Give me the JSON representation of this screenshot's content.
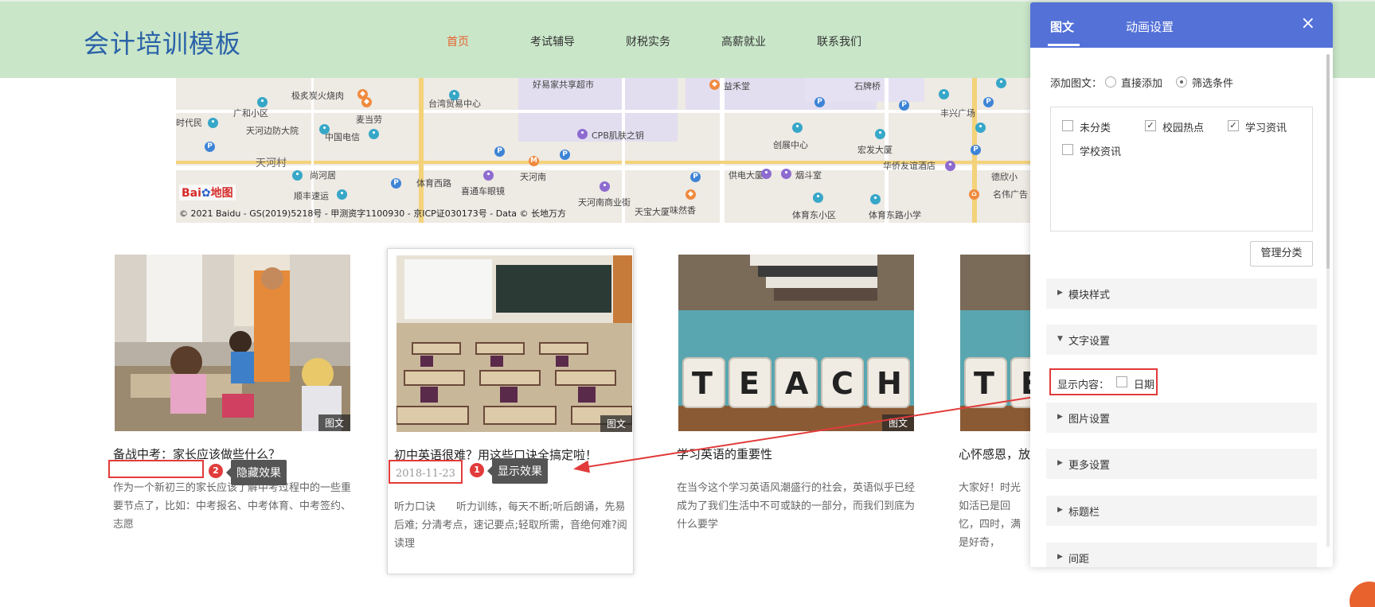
{
  "site": {
    "title": "会计培训模板"
  },
  "nav": [
    {
      "label": "首页",
      "active": true
    },
    {
      "label": "考试辅导",
      "active": false
    },
    {
      "label": "财税实务",
      "active": false
    },
    {
      "label": "高薪就业",
      "active": false
    },
    {
      "label": "联系我们",
      "active": false
    }
  ],
  "map": {
    "labels": [
      "极炙炭火烧肉",
      "广和小区",
      "天河边防大院",
      "时代民",
      "好易家共享超市",
      "麦当劳",
      "台湾贸易中心",
      "中国电信",
      "CPB肌肤之钥",
      "天河村",
      "尚河居",
      "顺丰速运",
      "体育西路",
      "喜通车眼镜",
      "天河南",
      "天河南商业街",
      "益禾堂",
      "石牌桥",
      "创展中心",
      "宏发大厦",
      "丰兴广场",
      "华侨友谊酒店",
      "供电大厦",
      "烟斗室",
      "味然香",
      "天宝大厦",
      "体育东小区",
      "体育东路小学",
      "德欣小",
      "名伟广告"
    ],
    "logo_text": "Bai",
    "logo_suffix": "地图",
    "copyright": "© 2021 Baidu - GS(2019)5218号 - 甲测资字1100930 - 京ICP证030173号 - Data © 长地万方"
  },
  "cards": [
    {
      "title": "备战中考：家长应该做些什么？",
      "date": "",
      "tag": "图文",
      "desc": "作为一个新初三的家长应该了解中考过程中的一些重要节点了，比如：中考报名、中考体育、中考签约、志愿"
    },
    {
      "title": "初中英语很难？用这些口诀全搞定啦！",
      "date": "2018-11-23",
      "tag": "图文",
      "desc": "听力口诀　　听力训练，每天不断;听后朗诵，先易后难; 分清考点，速记要点;轻取所需，音绝何难?阅读理"
    },
    {
      "title": "学习英语的重要性",
      "date": "",
      "tag": "图文",
      "desc": "在当今这个学习英语风潮盛行的社会，英语似乎已经成为了我们生活中不可或缺的一部分，而我们到底为什么要学"
    },
    {
      "title": "心怀感恩，放",
      "date": "",
      "tag": "",
      "desc": "大家好！时光如活已是回忆，四时，满是好奇，"
    }
  ],
  "teach_letters": [
    "T",
    "E",
    "A",
    "C",
    "H"
  ],
  "annotations": {
    "hide": {
      "num": "2",
      "label": "隐藏效果"
    },
    "show": {
      "num": "1",
      "label": "显示效果"
    }
  },
  "panel": {
    "tabs": [
      {
        "label": "图文",
        "active": true
      },
      {
        "label": "动画设置",
        "active": false
      }
    ],
    "close_icon": "×",
    "add_label": "添加图文：",
    "add_options": [
      {
        "label": "直接添加",
        "checked": false
      },
      {
        "label": "筛选条件",
        "checked": true
      }
    ],
    "categories": [
      {
        "label": "未分类",
        "checked": false
      },
      {
        "label": "校园热点",
        "checked": true
      },
      {
        "label": "学习资讯",
        "checked": true
      },
      {
        "label": "学校资讯",
        "checked": false
      }
    ],
    "manage_button": "管理分类",
    "sections": {
      "module_style": "模块样式",
      "text_settings": "文字设置",
      "image_settings": "图片设置",
      "more_settings": "更多设置",
      "title_bar": "标题栏",
      "spacing": "间距"
    },
    "display_label": "显示内容：",
    "display_option": {
      "label": "日期",
      "checked": false
    }
  },
  "colors": {
    "header_bg": "#c9e6c9",
    "brand_title": "#2a62a8",
    "nav_active": "#e8622e",
    "panel_head": "#5471d8",
    "annotation_red": "#e23b3b"
  }
}
